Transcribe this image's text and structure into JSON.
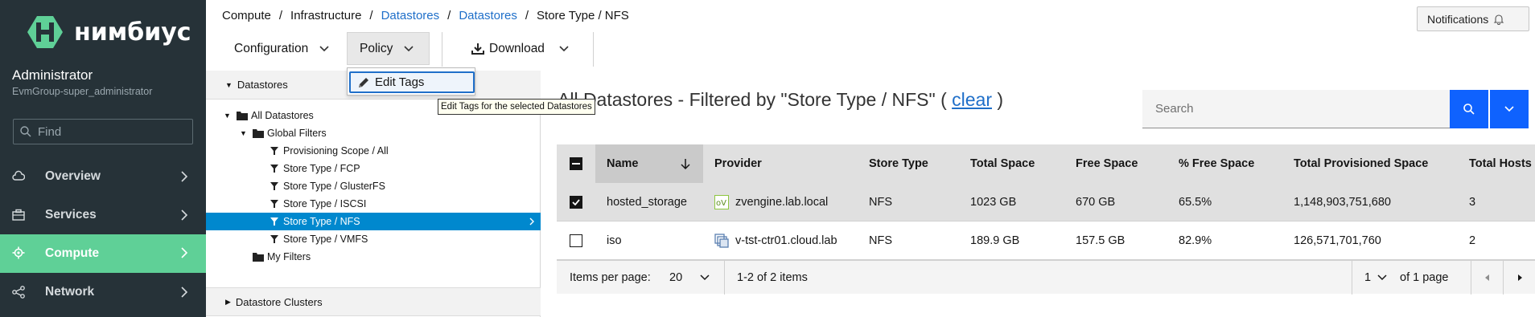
{
  "brand": {
    "name": "нимбиус"
  },
  "user": {
    "name": "Administrator",
    "group": "EvmGroup-super_administrator"
  },
  "search_nav": {
    "placeholder": "Find"
  },
  "nav": [
    {
      "label": "Overview",
      "icon": "cloud-icon"
    },
    {
      "label": "Services",
      "icon": "briefcase-icon"
    },
    {
      "label": "Compute",
      "icon": "gear-icon",
      "active": true
    },
    {
      "label": "Network",
      "icon": "network-icon"
    }
  ],
  "breadcrumb": [
    "Compute",
    "Infrastructure",
    "Datastores",
    "Datastores",
    "Store Type / NFS"
  ],
  "notifications": {
    "label": "Notifications"
  },
  "toolbar": {
    "configuration": "Configuration",
    "policy": "Policy",
    "download": "Download"
  },
  "policy_menu": {
    "edit_tags": "Edit Tags"
  },
  "tooltip": "Edit Tags for the selected Datastores",
  "tree": {
    "accordion_datastores": "Datastores",
    "accordion_clusters": "Datastore Clusters",
    "all": "All Datastores",
    "global_filters": "Global Filters",
    "filters": [
      "Provisioning Scope / All",
      "Store Type / FCP",
      "Store Type / GlusterFS",
      "Store Type / ISCSI",
      "Store Type / NFS",
      "Store Type / VMFS"
    ],
    "selected": "Store Type / NFS",
    "my_filters": "My Filters"
  },
  "main": {
    "title_prefix": "All Datastores - Filtered by \"Store Type / NFS\" (",
    "clear": "clear",
    "title_suffix": ")",
    "search_placeholder": "Search"
  },
  "table": {
    "columns": [
      "Name",
      "Provider",
      "Store Type",
      "Total Space",
      "Free Space",
      "% Free Space",
      "Total Provisioned Space",
      "Total Hosts"
    ],
    "rows": [
      {
        "checked": true,
        "name": "hosted_storage",
        "provider": "zvengine.lab.local",
        "provider_icon": "ovirt-icon",
        "store_type": "NFS",
        "total_space": "1023 GB",
        "free_space": "670 GB",
        "pct_free": "65.5%",
        "provisioned": "1,148,903,751,680",
        "hosts": "3"
      },
      {
        "checked": false,
        "name": "iso",
        "provider": "v-tst-ctr01.cloud.lab",
        "provider_icon": "vmware-icon",
        "store_type": "NFS",
        "total_space": "189.9 GB",
        "free_space": "157.5 GB",
        "pct_free": "82.9%",
        "provisioned": "126,571,701,760",
        "hosts": "2"
      }
    ]
  },
  "pagination": {
    "items_per_page_label": "Items per page:",
    "items_per_page": "20",
    "range": "1-2 of 2 items",
    "page": "1",
    "of_pages": "of 1 page"
  },
  "colors": {
    "sidebar": "#263238",
    "active": "#5fd097",
    "link": "#1f6fc9",
    "primary": "#0f62fe",
    "tree_selected": "#0088ce"
  }
}
